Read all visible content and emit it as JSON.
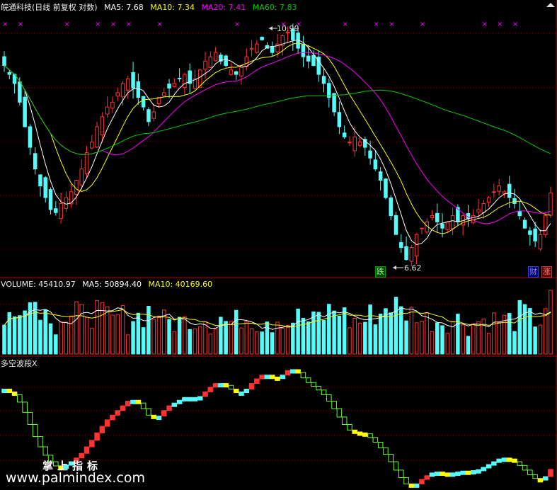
{
  "header": {
    "stock_label": "皖通科技(日线 前复权 对数)",
    "ma5": "MA5: 7.68",
    "ma10": "MA10: 7.34",
    "ma20": "MA20: 7.41",
    "ma60": "MA60: 7.83"
  },
  "volume_header": {
    "label": "VOLUME: 45410.97",
    "ma5": "MA5: 50894.40",
    "ma10": "MA10: 40169.60"
  },
  "indicator_header": {
    "label": "多空波段X"
  },
  "annotations": {
    "high": "10.99",
    "low": "6.62"
  },
  "badges": {
    "die": "跌",
    "cai": "财",
    "zhang": "涨"
  },
  "watermark": {
    "line1": "掌上指标",
    "line2": "www.palmindex.com"
  },
  "colors": {
    "up": "#ff3333",
    "down": "#54fcfc",
    "ma5": "#ffffff",
    "ma10": "#ffff00",
    "ma20": "#ff00ff",
    "ma60": "#00cc00",
    "panel_border": "#b00000",
    "grid": "#800000"
  },
  "chart_data": {
    "type": "candlestick",
    "price_range": [
      6.4,
      11.4
    ],
    "marked_high": 10.99,
    "marked_low": 6.62,
    "ma_latest": {
      "MA5": 7.68,
      "MA10": 7.34,
      "MA20": 7.41,
      "MA60": 7.83
    },
    "volume_latest": 45410.97,
    "volume_ma_latest": {
      "MA5": 50894.4,
      "MA10": 40169.6
    },
    "close_series": [
      10.2,
      10.0,
      9.8,
      9.4,
      8.9,
      8.5,
      8.1,
      7.8,
      7.6,
      7.4,
      7.35,
      7.5,
      7.6,
      7.7,
      7.9,
      8.1,
      8.4,
      8.6,
      8.9,
      9.1,
      9.3,
      9.4,
      9.6,
      9.8,
      9.9,
      9.7,
      9.5,
      9.3,
      9.0,
      9.2,
      9.5,
      9.6,
      9.7,
      9.8,
      9.9,
      10.0,
      9.8,
      9.9,
      10.1,
      10.3,
      10.4,
      10.5,
      10.3,
      10.2,
      10.1,
      10.0,
      10.2,
      10.4,
      10.6,
      10.7,
      10.8,
      10.6,
      10.5,
      10.7,
      10.9,
      10.99,
      10.8,
      10.6,
      10.4,
      10.3,
      10.2,
      10.0,
      9.8,
      9.5,
      9.2,
      8.9,
      8.7,
      8.6,
      8.7,
      8.6,
      8.5,
      8.3,
      8.1,
      7.9,
      7.6,
      7.3,
      7.0,
      6.8,
      6.62,
      6.8,
      7.0,
      7.1,
      7.2,
      7.3,
      7.2,
      7.1,
      7.2,
      7.3,
      7.2,
      7.3,
      7.25,
      7.3,
      7.4,
      7.5,
      7.6,
      7.7,
      7.8,
      7.7,
      7.6,
      7.5,
      7.3,
      7.1,
      7.0,
      6.9,
      7.0,
      7.3,
      7.68
    ]
  }
}
